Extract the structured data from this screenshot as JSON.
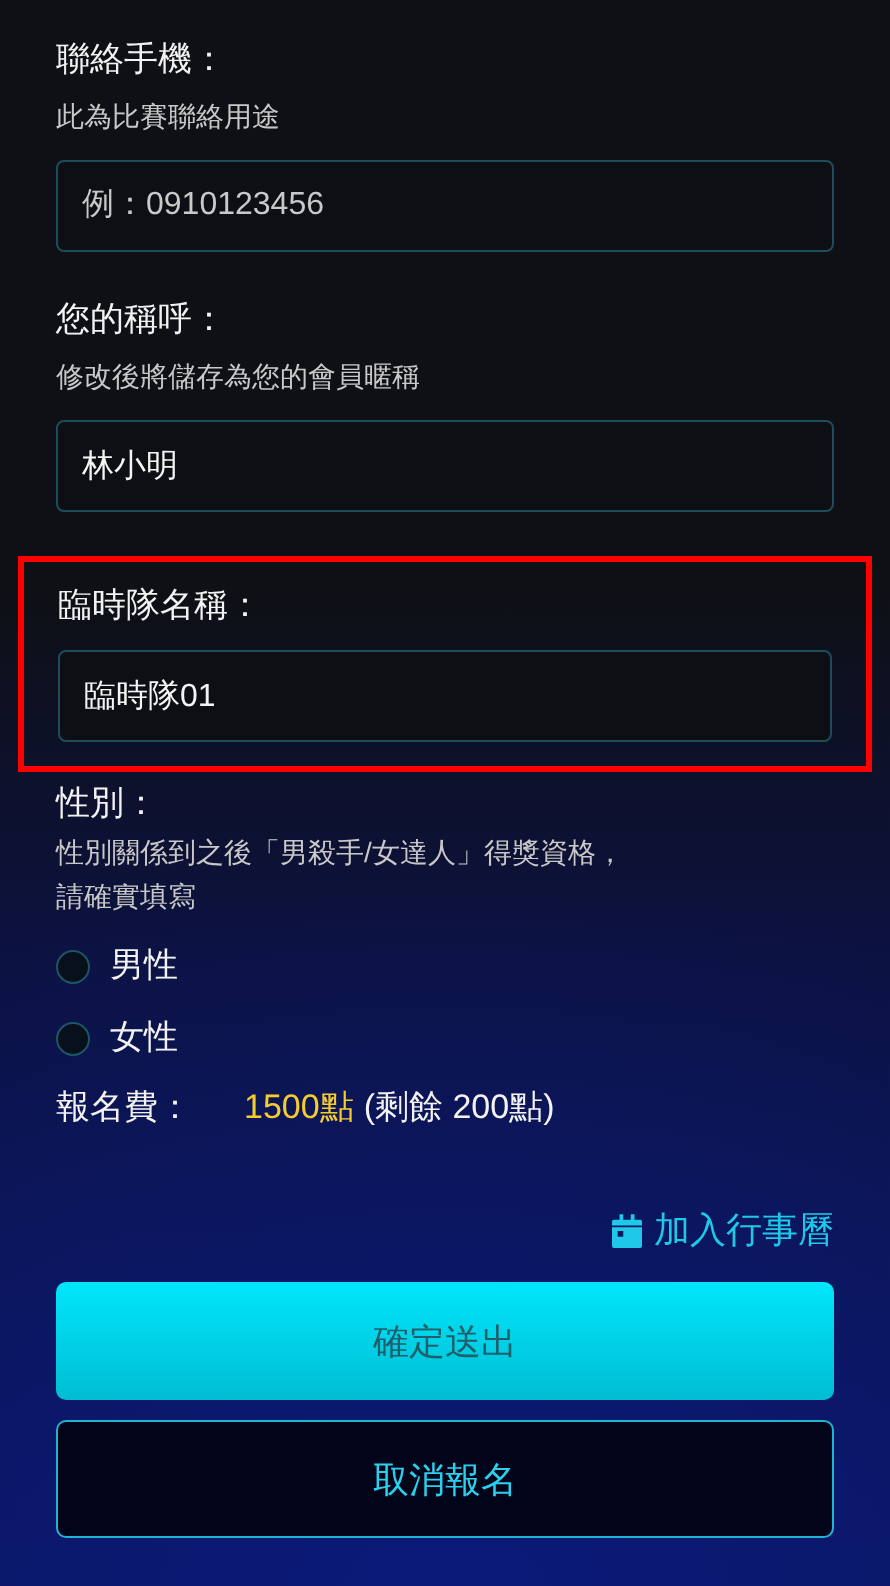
{
  "fields": [
    {
      "label": "聯絡手機：",
      "hint": "此為比賽聯絡用途",
      "placeholder": "例：0910123456",
      "highlighted": false
    },
    {
      "label": "您的稱呼：",
      "hint": "修改後將儲存為您的會員暱稱",
      "value": "林小明",
      "highlighted": false
    },
    {
      "label": "臨時隊名稱：",
      "value": "臨時隊01",
      "highlighted": true
    }
  ],
  "gender": {
    "label": "性別：",
    "hint_lines": [
      "性別關係到之後「男殺手/女達人」得獎資格，",
      "請確實填寫"
    ],
    "options": [
      {
        "label": "男性",
        "selected": false
      },
      {
        "label": "女性",
        "selected": false
      }
    ]
  },
  "fee": {
    "label": "報名費：",
    "amount": "1500點",
    "remaining": "(剩餘 200點)"
  },
  "calendar_link": "加入行事曆",
  "buttons": [
    {
      "label": "確定送出",
      "kind": "primary"
    },
    {
      "label": "取消報名",
      "kind": "secondary"
    }
  ]
}
